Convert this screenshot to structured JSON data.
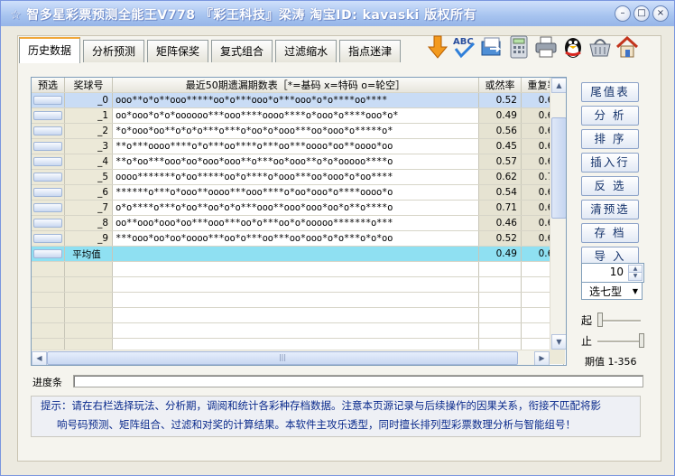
{
  "app": {
    "title": "☆ 智多星彩票预测全能王V778 『彩王科技』梁涛 淘宝ID: kavaski 版权所有",
    "minimize_icon": "minimize-icon",
    "maximize_icon": "maximize-icon",
    "close_icon": "close-icon"
  },
  "tabs": [
    {
      "label": "历史数据",
      "active": true
    },
    {
      "label": "分析预测"
    },
    {
      "label": "矩阵保奖"
    },
    {
      "label": "复式组合"
    },
    {
      "label": "过滤缩水"
    },
    {
      "label": "指点迷津"
    }
  ],
  "toolbar": [
    "down-arrow-icon",
    "spellcheck-icon",
    "export-icon",
    "calculator-icon",
    "printer-icon",
    "qq-penguin-icon",
    "basket-icon",
    "home-icon"
  ],
  "table": {
    "headers": {
      "pre": "预选",
      "ball": "奖球号",
      "pattern": "最近50期遗漏期数表［*=基码 x=特码 o=轮空］",
      "rate": "或然率",
      "repeat": "重复率"
    },
    "rows": [
      {
        "ball": "_0",
        "pattern": "ooo**o*o**ooo*****oo*o***ooo*o***ooo*o*o****oo****",
        "rate": "0.52",
        "repeat": "0.63"
      },
      {
        "ball": "_1",
        "pattern": "oo*ooo*o*o*oooooo***ooo****oooo****o*ooo*o****ooo*o*",
        "rate": "0.49",
        "repeat": "0.62"
      },
      {
        "ball": "_2",
        "pattern": "*o*ooo*oo**o*o*o***o***o*oo*o*ooo***oo*ooo*o*****o*",
        "rate": "0.56",
        "repeat": "0.67"
      },
      {
        "ball": "_3",
        "pattern": "**o***oooo****o*o***oo****o***oo***oooo*oo**oooo*oo",
        "rate": "0.45",
        "repeat": "0.63"
      },
      {
        "ball": "_4",
        "pattern": "**o*oo***ooo*oo*ooo*ooo**o***oo*ooo**o*o*ooooo****o",
        "rate": "0.57",
        "repeat": "0.63"
      },
      {
        "ball": "_5",
        "pattern": "oooo*******o*oo*****oo*o****o*ooo***oo*ooo*o*oo****",
        "rate": "0.62",
        "repeat": "0.72"
      },
      {
        "ball": "_6",
        "pattern": "******o***o*ooo**oooo***ooo****o*oo*ooo*o****oooo*o",
        "rate": "0.54",
        "repeat": "0.62"
      },
      {
        "ball": "_7",
        "pattern": "o*o****o***o*oo**oo*o*o***ooo**ooo*ooo*oo*o**o****o",
        "rate": "0.71",
        "repeat": "0.67"
      },
      {
        "ball": "_8",
        "pattern": "oo**ooo*ooo*oo***ooo***oo*o***oo*o*ooooo*******o***",
        "rate": "0.46",
        "repeat": "0.60"
      },
      {
        "ball": "_9",
        "pattern": "***ooo*oo*oo*oooo***oo*o***oo***oo*ooo*o*o***o*o*oo",
        "rate": "0.52",
        "repeat": "0.60"
      }
    ],
    "average": {
      "ball": "平均值",
      "rate": "0.49",
      "repeat": "0.64"
    }
  },
  "side_buttons": [
    "尾值表",
    "分 析",
    "排 序",
    "插入行",
    "反 选",
    "清预选",
    "存 档",
    "导 入"
  ],
  "spinner": {
    "value": "10"
  },
  "select": {
    "value": "选七型"
  },
  "sliders": {
    "start_label": "起",
    "end_label": "止"
  },
  "period": {
    "label": "期值",
    "range": "1-356"
  },
  "progress": {
    "label": "进度条"
  },
  "hint": {
    "line1": "提示：请在右栏选择玩法、分析期，调阅和统计各彩种存档数据。注意本页源记录与后续操作的因果关系，衔接不匹配将影",
    "line2": "响号码预测、矩阵组合、过滤和对奖的计算结果。本软件主攻乐透型，同时擅长排列型彩票数理分析与智能组号！"
  }
}
